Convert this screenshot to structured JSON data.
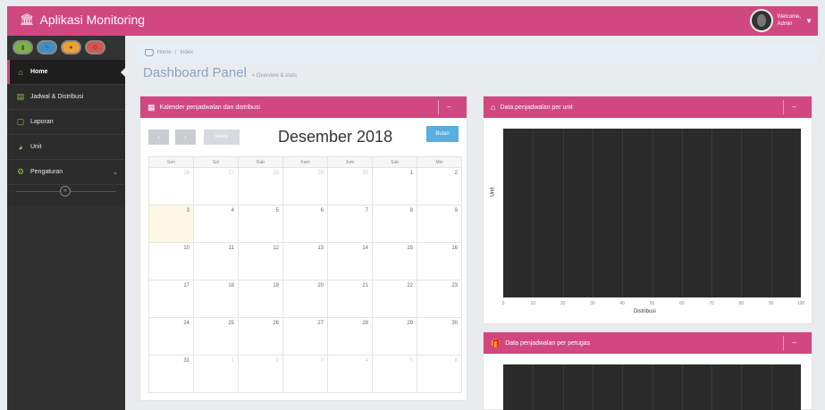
{
  "app": {
    "title": "Aplikasi Monitoring",
    "icon": "bank-icon"
  },
  "user": {
    "line1": "Welcome,",
    "line2": "Admin"
  },
  "shortcuts": [
    {
      "icon": "signal-icon"
    },
    {
      "icon": "pencil-icon"
    },
    {
      "icon": "users-icon"
    },
    {
      "icon": "cogs-icon"
    }
  ],
  "nav": [
    {
      "label": "Home",
      "icon": "home-icon",
      "active": true
    },
    {
      "label": "Jadwal & Distribusi",
      "icon": "list-icon"
    },
    {
      "label": "Laporan",
      "icon": "document-icon"
    },
    {
      "label": "Unit",
      "icon": "dashboard-icon"
    },
    {
      "label": "Pengaturan",
      "icon": "cogs-icon",
      "has_submenu": true
    }
  ],
  "breadcrumb": {
    "home": "Home",
    "separator": "/",
    "current": "Index"
  },
  "page": {
    "title": "Dashboard Panel",
    "subtitle": "» Overview & stats"
  },
  "calendar_widget": {
    "title": "Kalender penjadwalan dan distribusi",
    "toolbar": {
      "prev": "‹",
      "next": "›",
      "today": "today",
      "month_title": "Desember 2018",
      "now_button": "Bulan"
    },
    "weekdays": [
      "Sen",
      "Sel",
      "Rab",
      "Kam",
      "Jum",
      "Sab",
      "Min"
    ],
    "weeks": [
      [
        {
          "d": "26",
          "o": true
        },
        {
          "d": "27",
          "o": true
        },
        {
          "d": "28",
          "o": true
        },
        {
          "d": "29",
          "o": true
        },
        {
          "d": "30",
          "o": true
        },
        {
          "d": "1"
        },
        {
          "d": "2"
        }
      ],
      [
        {
          "d": "3",
          "t": true
        },
        {
          "d": "4"
        },
        {
          "d": "5"
        },
        {
          "d": "6"
        },
        {
          "d": "7"
        },
        {
          "d": "8"
        },
        {
          "d": "9"
        }
      ],
      [
        {
          "d": "10"
        },
        {
          "d": "11"
        },
        {
          "d": "12"
        },
        {
          "d": "13"
        },
        {
          "d": "14"
        },
        {
          "d": "15"
        },
        {
          "d": "16"
        }
      ],
      [
        {
          "d": "17"
        },
        {
          "d": "18"
        },
        {
          "d": "19"
        },
        {
          "d": "20"
        },
        {
          "d": "21"
        },
        {
          "d": "22"
        },
        {
          "d": "23"
        }
      ],
      [
        {
          "d": "24"
        },
        {
          "d": "25"
        },
        {
          "d": "26"
        },
        {
          "d": "27"
        },
        {
          "d": "28"
        },
        {
          "d": "29"
        },
        {
          "d": "30"
        }
      ],
      [
        {
          "d": "31"
        },
        {
          "d": "1",
          "o": true
        },
        {
          "d": "2",
          "o": true
        },
        {
          "d": "3",
          "o": true
        },
        {
          "d": "4",
          "o": true
        },
        {
          "d": "5",
          "o": true
        },
        {
          "d": "6",
          "o": true
        }
      ]
    ]
  },
  "chart_widget_1": {
    "title": "Data penjadwalan per unit",
    "toggle": "–",
    "icon": "home-icon"
  },
  "chart_widget_2": {
    "title": "Data penjadwalan per petugas",
    "toggle": "–",
    "icon": "gift-icon"
  },
  "chart_data": [
    {
      "type": "bar",
      "orientation": "horizontal",
      "title": "",
      "xlabel": "Distribusi",
      "ylabel": "Unit",
      "xlim": [
        0,
        100
      ],
      "x_ticks": [
        "0",
        "10",
        "20",
        "30",
        "40",
        "50",
        "60",
        "70",
        "80",
        "90",
        "100"
      ],
      "background": "#2b2b2b",
      "series": []
    },
    {
      "type": "bar",
      "title": "",
      "background": "#2b2b2b",
      "series": []
    }
  ]
}
